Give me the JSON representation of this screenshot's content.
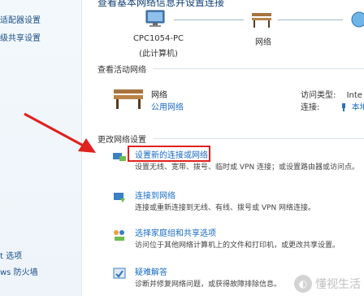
{
  "left_nav": {
    "items": [
      {
        "label": "适配器设置"
      },
      {
        "label": "级共享设置"
      }
    ],
    "see_also": [
      {
        "label": "t 选项"
      },
      {
        "label": "ws 防火墙"
      }
    ]
  },
  "header": {
    "title": "查看基本网络信息并设置连接"
  },
  "map": {
    "computer_name": "CPC1054-PC",
    "computer_sub": "(此计算机)",
    "network_label": "网络"
  },
  "active_section": {
    "label": "查看活动网络",
    "network_name": "网络",
    "network_type": "公用网络",
    "access_type_label": "访问类型:",
    "access_type_value": "Inte",
    "connections_label": "连接:",
    "connections_value": "本地"
  },
  "change_section": {
    "label": "更改网络设置",
    "items": [
      {
        "title": "设置新的连接或网络",
        "desc": "设置无线、宽带、拨号、临时或 VPN 连接；或设置路由器或访问点。"
      },
      {
        "title": "连接到网络",
        "desc": "连接或重新连接到无线、有线、拨号或 VPN 网络连接。"
      },
      {
        "title": "选择家庭组和共享选项",
        "desc": "访问位于其他网络计算机上的文件和打印机，或更改共享设置。"
      },
      {
        "title": "疑难解答",
        "desc": "诊断并修复网络问题，或获得故障排除信息。"
      }
    ]
  },
  "watermark": {
    "text": "懂视生活"
  },
  "colors": {
    "link": "#1a6ac2",
    "highlight": "#e0211d",
    "arrow": "#e0211d"
  }
}
